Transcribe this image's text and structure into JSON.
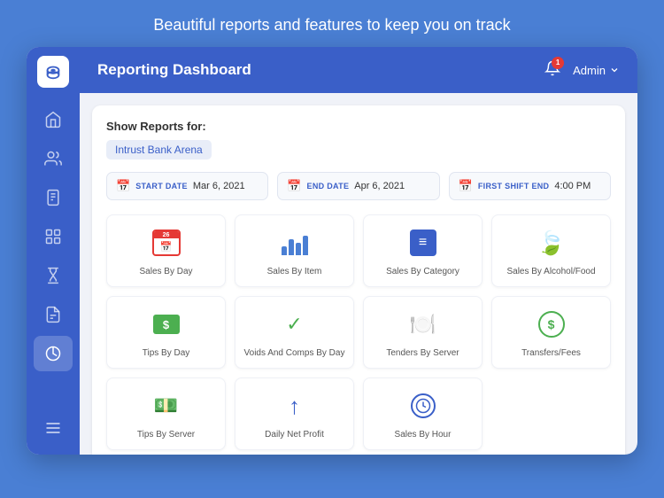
{
  "page": {
    "top_title": "Beautiful reports and features to keep you on track"
  },
  "header": {
    "title": "Reporting Dashboard",
    "notification_count": "1",
    "admin_label": "Admin"
  },
  "sidebar": {
    "items": [
      {
        "id": "dashboard",
        "icon": "dashboard-icon",
        "active": true
      },
      {
        "id": "users",
        "icon": "users-icon",
        "active": false
      },
      {
        "id": "reports",
        "icon": "reports-icon",
        "active": false
      },
      {
        "id": "settings",
        "icon": "settings-icon",
        "active": false
      },
      {
        "id": "hourglass",
        "icon": "hourglass-icon",
        "active": false
      },
      {
        "id": "document",
        "icon": "document-icon",
        "active": false
      },
      {
        "id": "analytics",
        "icon": "analytics-icon",
        "active": true
      }
    ],
    "menu_icon": "menu-icon"
  },
  "filters": {
    "show_reports_label": "Show Reports for:",
    "venue": "Intrust Bank Arena",
    "start_date_label": "START DATE",
    "start_date_value": "Mar 6, 2021",
    "end_date_label": "END DATE",
    "end_date_value": "Apr 6, 2021",
    "shift_end_label": "FIRST SHIFT END",
    "shift_end_value": "4:00 PM"
  },
  "reports": [
    {
      "id": "sales-by-day",
      "label": "Sales By Day",
      "icon_type": "calendar"
    },
    {
      "id": "sales-by-item",
      "label": "Sales By Item",
      "icon_type": "bar"
    },
    {
      "id": "sales-by-category",
      "label": "Sales By Category",
      "icon_type": "category"
    },
    {
      "id": "sales-by-alcohol",
      "label": "Sales By Alcohol/Food",
      "icon_type": "leaf"
    },
    {
      "id": "tips-by-day",
      "label": "Tips By Day",
      "icon_type": "money"
    },
    {
      "id": "voids-and-comps",
      "label": "Voids And Comps By Day",
      "icon_type": "check"
    },
    {
      "id": "tenders-by-server",
      "label": "Tenders By Server",
      "icon_type": "server"
    },
    {
      "id": "transfers-fees",
      "label": "Transfers/Fees",
      "icon_type": "transfer"
    },
    {
      "id": "tips-by-server",
      "label": "Tips By Server",
      "icon_type": "tip"
    },
    {
      "id": "daily-net-profit",
      "label": "Daily Net Profit",
      "icon_type": "arrow"
    },
    {
      "id": "sales-by-hour",
      "label": "Sales By Hour",
      "icon_type": "clock"
    }
  ]
}
